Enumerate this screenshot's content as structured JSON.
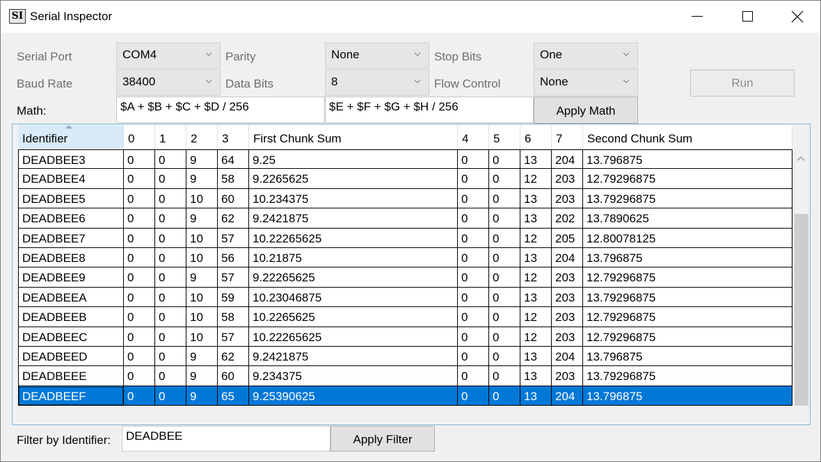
{
  "window": {
    "icon_text": "SI",
    "title": "Serial Inspector",
    "icons": [
      "minimize-icon",
      "maximize-icon",
      "close-icon"
    ]
  },
  "settings": {
    "serial_port_label": "Serial Port",
    "serial_port_value": "COM4",
    "baud_rate_label": "Baud Rate",
    "baud_rate_value": "38400",
    "parity_label": "Parity",
    "parity_value": "None",
    "data_bits_label": "Data Bits",
    "data_bits_value": "8",
    "stop_bits_label": "Stop Bits",
    "stop_bits_value": "One",
    "flow_control_label": "Flow Control",
    "flow_control_value": "None",
    "run_label": "Run"
  },
  "math": {
    "label": "Math:",
    "first_expression": "$A + $B + $C + $D / 256",
    "second_expression": "$E + $F + $G + $H / 256",
    "apply_label": "Apply Math"
  },
  "table": {
    "columns": [
      "Identifier",
      "0",
      "1",
      "2",
      "3",
      "First Chunk Sum",
      "4",
      "5",
      "6",
      "7",
      "Second Chunk Sum"
    ],
    "sorted_column": "Identifier",
    "rows": [
      [
        "DEADBEE3",
        "0",
        "0",
        "9",
        "64",
        "9.25",
        "0",
        "0",
        "13",
        "204",
        "13.796875"
      ],
      [
        "DEADBEE4",
        "0",
        "0",
        "9",
        "58",
        "9.2265625",
        "0",
        "0",
        "12",
        "203",
        "12.79296875"
      ],
      [
        "DEADBEE5",
        "0",
        "0",
        "10",
        "60",
        "10.234375",
        "0",
        "0",
        "13",
        "203",
        "13.79296875"
      ],
      [
        "DEADBEE6",
        "0",
        "0",
        "9",
        "62",
        "9.2421875",
        "0",
        "0",
        "13",
        "202",
        "13.7890625"
      ],
      [
        "DEADBEE7",
        "0",
        "0",
        "10",
        "57",
        "10.22265625",
        "0",
        "0",
        "12",
        "205",
        "12.80078125"
      ],
      [
        "DEADBEE8",
        "0",
        "0",
        "10",
        "56",
        "10.21875",
        "0",
        "0",
        "13",
        "204",
        "13.796875"
      ],
      [
        "DEADBEE9",
        "0",
        "0",
        "9",
        "57",
        "9.22265625",
        "0",
        "0",
        "12",
        "203",
        "12.79296875"
      ],
      [
        "DEADBEEA",
        "0",
        "0",
        "10",
        "59",
        "10.23046875",
        "0",
        "0",
        "13",
        "203",
        "13.79296875"
      ],
      [
        "DEADBEEB",
        "0",
        "0",
        "10",
        "58",
        "10.2265625",
        "0",
        "0",
        "12",
        "203",
        "12.79296875"
      ],
      [
        "DEADBEEC",
        "0",
        "0",
        "10",
        "57",
        "10.22265625",
        "0",
        "0",
        "12",
        "203",
        "12.79296875"
      ],
      [
        "DEADBEED",
        "0",
        "0",
        "9",
        "62",
        "9.2421875",
        "0",
        "0",
        "13",
        "204",
        "13.796875"
      ],
      [
        "DEADBEEE",
        "0",
        "0",
        "9",
        "60",
        "9.234375",
        "0",
        "0",
        "13",
        "203",
        "13.79296875"
      ],
      [
        "DEADBEEF",
        "0",
        "0",
        "9",
        "65",
        "9.25390625",
        "0",
        "0",
        "13",
        "204",
        "13.796875"
      ]
    ],
    "selected_row": 12,
    "selection_color": "#0078d7"
  },
  "filter": {
    "label": "Filter by Identifier:",
    "value": "DEADBEE",
    "apply_label": "Apply Filter"
  }
}
